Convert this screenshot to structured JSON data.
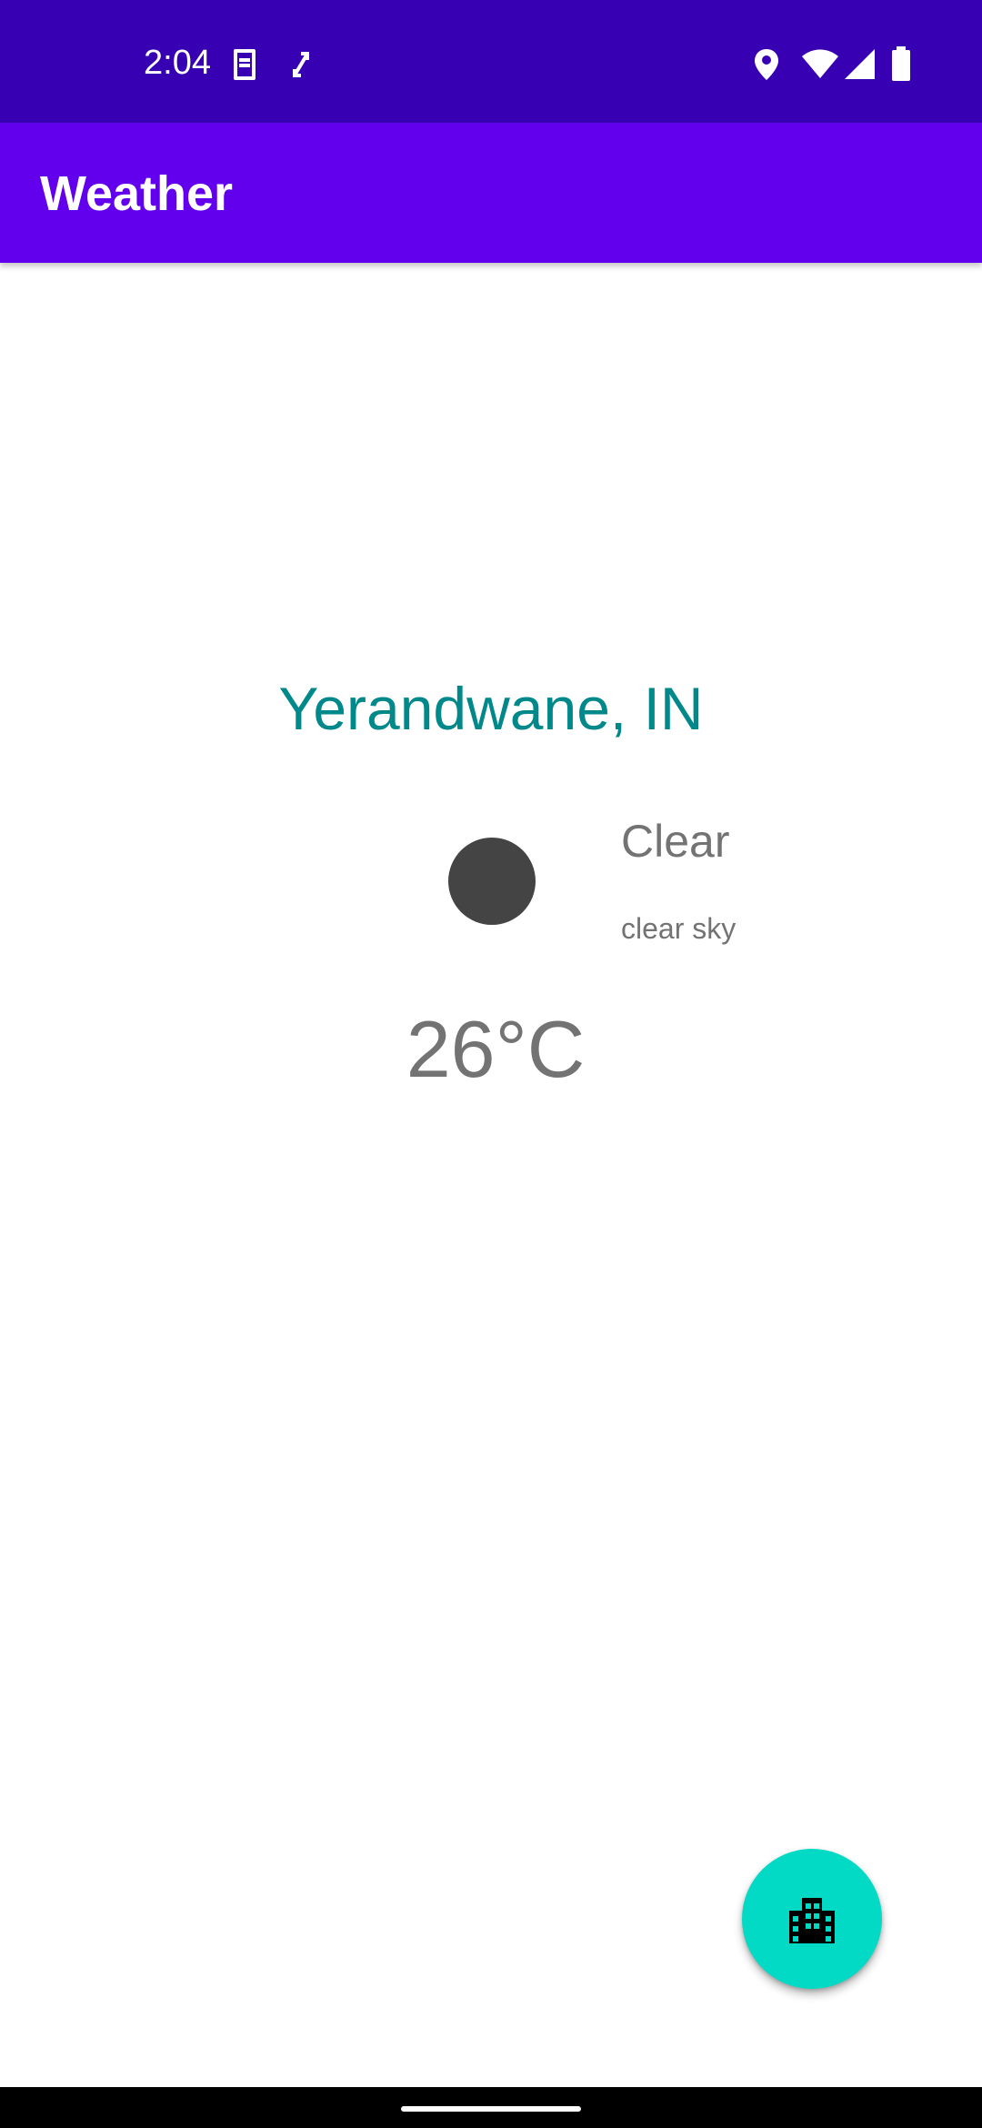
{
  "status_bar": {
    "time": "2:04",
    "left_icons": [
      "sim-toolkit-icon",
      "sync-arrows-icon"
    ],
    "right_icons": [
      "location-icon",
      "wifi-icon",
      "signal-icon",
      "battery-icon"
    ],
    "background": "#3700b3"
  },
  "app_bar": {
    "title": "Weather",
    "background": "#6200ee"
  },
  "weather": {
    "city": "Yerandwane, IN",
    "icon": "weather-condition-icon",
    "main": "Clear",
    "description": "clear sky",
    "temperature": "26°C",
    "city_color": "#00888a",
    "text_color": "#737373"
  },
  "fab": {
    "icon": "city-icon",
    "background": "#03dac5"
  },
  "nav_bar": {
    "background": "#000000"
  }
}
